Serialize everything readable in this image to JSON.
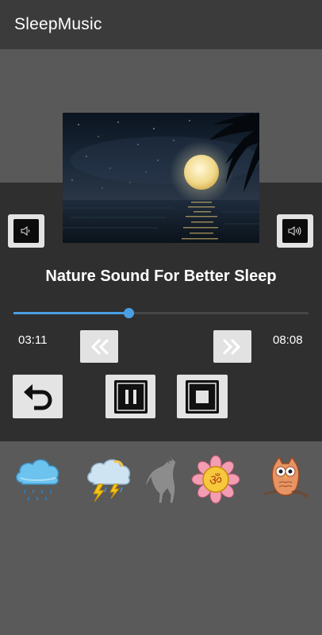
{
  "app": {
    "title": "SleepMusic"
  },
  "player": {
    "track_title": "Nature Sound For Better Sleep",
    "current_time": "03:11",
    "total_time": "08:08",
    "progress": 0.39
  },
  "controls": {
    "volume_down_icon": "volume-down-icon",
    "volume_up_icon": "volume-up-icon",
    "rewind_icon": "rewind-icon",
    "fast_forward_icon": "fast-forward-icon",
    "repeat_icon": "repeat-back-icon",
    "pause_icon": "pause-icon",
    "stop_icon": "stop-icon"
  },
  "sounds": [
    {
      "icon": "rain-cloud-icon"
    },
    {
      "icon": "thunderstorm-icon"
    },
    {
      "icon": "howling-wolf-icon"
    },
    {
      "icon": "om-lotus-icon"
    },
    {
      "icon": "owl-icon"
    }
  ],
  "colors": {
    "accent": "#4a9fe3",
    "appbar": "#3b3b3b",
    "panel": "#2f2f2f",
    "background": "#595959"
  }
}
